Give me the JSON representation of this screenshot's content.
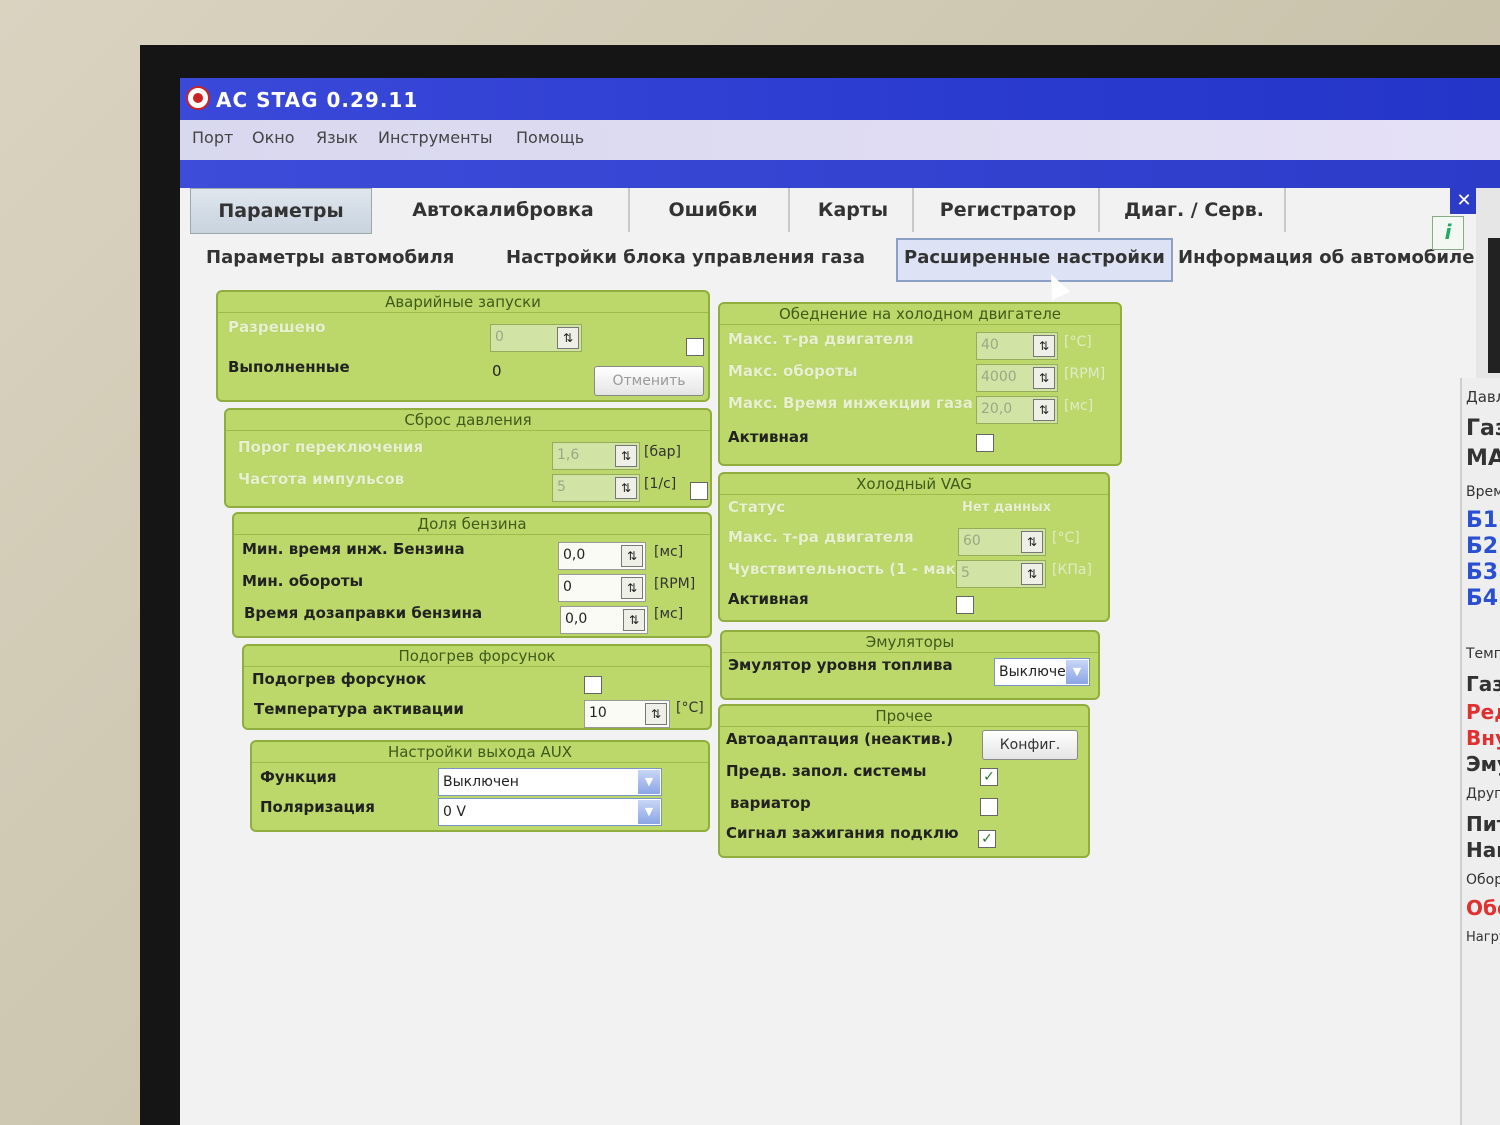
{
  "app": {
    "title": "AC STAG 0.29.11"
  },
  "menu": [
    "Порт",
    "Окно",
    "Язык",
    "Инструменты",
    "Помощь"
  ],
  "tabs": [
    "Параметры",
    "Автокалибровка",
    "Ошибки",
    "Карты",
    "Регистратор",
    "Диаг. / Серв."
  ],
  "subtabs": [
    "Параметры автомобиля",
    "Настройки блока управления газа",
    "Расширенные настройки",
    "Информация об автомобиле"
  ],
  "emergency": {
    "title": "Аварийные запуски",
    "allowed_label": "Разрешено",
    "allowed_value": "0",
    "done_label": "Выполненные",
    "done_value": "0",
    "cancel_label": "Отменить"
  },
  "pressure": {
    "title": "Сброс давления",
    "threshold_label": "Порог переключения",
    "threshold_value": "1,6",
    "threshold_unit": "[бар]",
    "freq_label": "Частота импульсов",
    "freq_value": "5",
    "freq_unit": "[1/с]"
  },
  "petrol": {
    "title": "Доля бензина",
    "min_time_label": "Мин. время инж. Бензина",
    "min_time_value": "0,0",
    "min_time_unit": "[мс]",
    "min_rpm_label": "Мин. обороты",
    "min_rpm_value": "0",
    "min_rpm_unit": "[RPM]",
    "refuel_label": "Время дозаправки бензина",
    "refuel_value": "0,0",
    "refuel_unit": "[мс]"
  },
  "heater": {
    "title": "Подогрев форсунок",
    "heat_label": "Подогрев форсунок",
    "temp_label": "Температура активации",
    "temp_value": "10",
    "temp_unit": "[°C]"
  },
  "aux": {
    "title": "Настройки выхода AUX",
    "func_label": "Функция",
    "func_value": "Выключен",
    "pol_label": "Поляризация",
    "pol_value": "0 V"
  },
  "cold_lean": {
    "title": "Обеднение на холодном двигателе",
    "temp_label": "Макс. т-ра двигателя",
    "temp_value": "40",
    "temp_unit": "[°C]",
    "rpm_label": "Макс. обороты",
    "rpm_value": "4000",
    "rpm_unit": "[RPM]",
    "inj_label": "Макс. Время инжекции газа",
    "inj_value": "20,0",
    "inj_unit": "[мс]",
    "active_label": "Активная"
  },
  "cold_vag": {
    "title": "Холодный VAG",
    "status_label": "Статус",
    "status_value": "Нет данных",
    "temp_label": "Макс. т-ра двигателя",
    "temp_value": "60",
    "temp_unit": "[°C]",
    "sens_label": "Чувствительность (1 - мак",
    "sens_value": "5",
    "sens_unit": "[КПа]",
    "active_label": "Активная"
  },
  "emulators": {
    "title": "Эмуляторы",
    "fuel_label": "Эмулятор уровня топлива",
    "fuel_value": "Выключе"
  },
  "other": {
    "title": "Прочее",
    "auto_label": "Автоадаптация (неактив.)",
    "config_label": "Конфиг.",
    "prefill_label": "Предв. запол. системы",
    "variator_label": "вариатор",
    "ignition_label": "Сигнал зажигания подклю"
  },
  "sidebar": [
    "Давл",
    "Газ",
    "МА",
    "Время",
    "Б1",
    "Б2",
    "Б3",
    "Б4",
    "Темпера",
    "Газ",
    "Ред.",
    "Внутр",
    "Эмул.",
    "Другие [V",
    "Питан",
    "Напря.",
    "Обороты [об",
    "Оборот",
    "Нагрузка дви"
  ]
}
